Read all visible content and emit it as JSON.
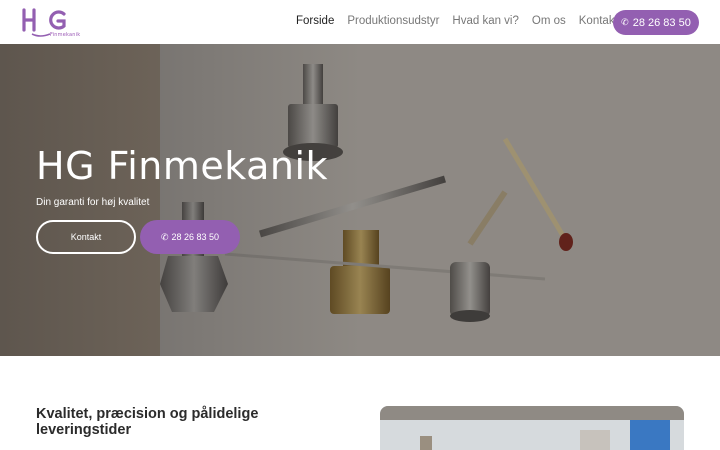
{
  "brand": {
    "logo_letters": "HG",
    "logo_subtext": "Finmekanik",
    "accent_color": "#935fb1"
  },
  "nav": {
    "items": [
      {
        "label": "Forside",
        "active": true
      },
      {
        "label": "Produktionsudstyr",
        "active": false
      },
      {
        "label": "Hvad kan vi?",
        "active": false
      },
      {
        "label": "Om os",
        "active": false
      },
      {
        "label": "Kontakt",
        "active": false
      }
    ],
    "phone_button": {
      "label": "28 26 83 50",
      "icon": "phone-icon"
    }
  },
  "hero": {
    "title": "HG Finmekanik",
    "subtitle": "Din garanti for høj kvalitet",
    "contact_button": "Kontakt",
    "phone_button": "28 26 83 50"
  },
  "content": {
    "section_title": "Kvalitet, præcision og pålidelige leveringstider"
  }
}
